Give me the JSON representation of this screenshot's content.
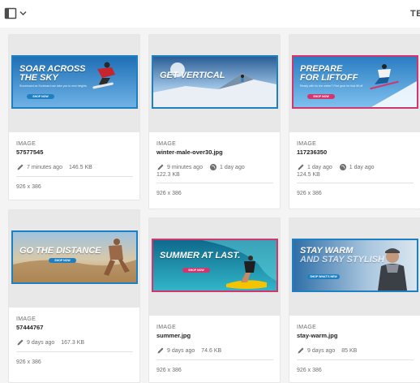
{
  "header": {
    "title": "TE",
    "rail_toggle_icon": "sidebar-panel-icon",
    "dropdown_icon": "chevron-down-icon"
  },
  "colors": {
    "selection_blue": "#1e7fc1",
    "selection_pink": "#d3356f"
  },
  "cards": [
    {
      "type": "IMAGE",
      "name": "57577545",
      "modified": "7 minutes ago",
      "size": "146.5 KB",
      "published": "",
      "dimensions": "926 x 386",
      "banner": {
        "line1": "SOAR ACROSS",
        "line2": "THE SKY",
        "sub": "Snowboard as Sunboard can take you to new heights",
        "button": "SHOP NOW",
        "accent": "blue"
      }
    },
    {
      "type": "IMAGE",
      "name": "winter-male-over30.jpg",
      "modified": "9 minutes ago",
      "size": "122.3 KB",
      "published": "1 day ago",
      "dimensions": "926 x 386",
      "banner": {
        "line1": "GET VERTICAL",
        "line2": "",
        "sub": "",
        "button": "",
        "accent": "blue"
      }
    },
    {
      "type": "IMAGE",
      "name": "117236350",
      "modified": "1 day ago",
      "size": "124.5 KB",
      "published": "1 day ago",
      "dimensions": "926 x 386",
      "banner": {
        "line1": "PREPARE",
        "line2": "FOR LIFTOFF",
        "sub": "Ready with for the winter? Find gear for that lift off",
        "button": "SHOP NOW",
        "accent": "pink"
      }
    },
    {
      "type": "IMAGE",
      "name": "57444767",
      "modified": "9 days ago",
      "size": "167.3 KB",
      "published": "",
      "dimensions": "926 x 386",
      "banner": {
        "line1": "GO THE DISTANCE",
        "line2": "",
        "sub": "",
        "button": "SHOP NOW",
        "accent": "blue"
      }
    },
    {
      "type": "IMAGE",
      "name": "summer.jpg",
      "modified": "9 days ago",
      "size": "74.6 KB",
      "published": "",
      "dimensions": "926 x 386",
      "banner": {
        "line1": "SUMMER AT LAST.",
        "line2": "",
        "sub": "",
        "button": "SHOP NOW",
        "accent": "pink"
      }
    },
    {
      "type": "IMAGE",
      "name": "stay-warm.jpg",
      "modified": "9 days ago",
      "size": "85 KB",
      "published": "",
      "dimensions": "926 x 386",
      "banner": {
        "line1": "STAY WARM",
        "line2": "AND STAY STYLISH",
        "sub": "",
        "button": "SHOP WHAT'S NEW",
        "accent": "blue"
      }
    }
  ]
}
